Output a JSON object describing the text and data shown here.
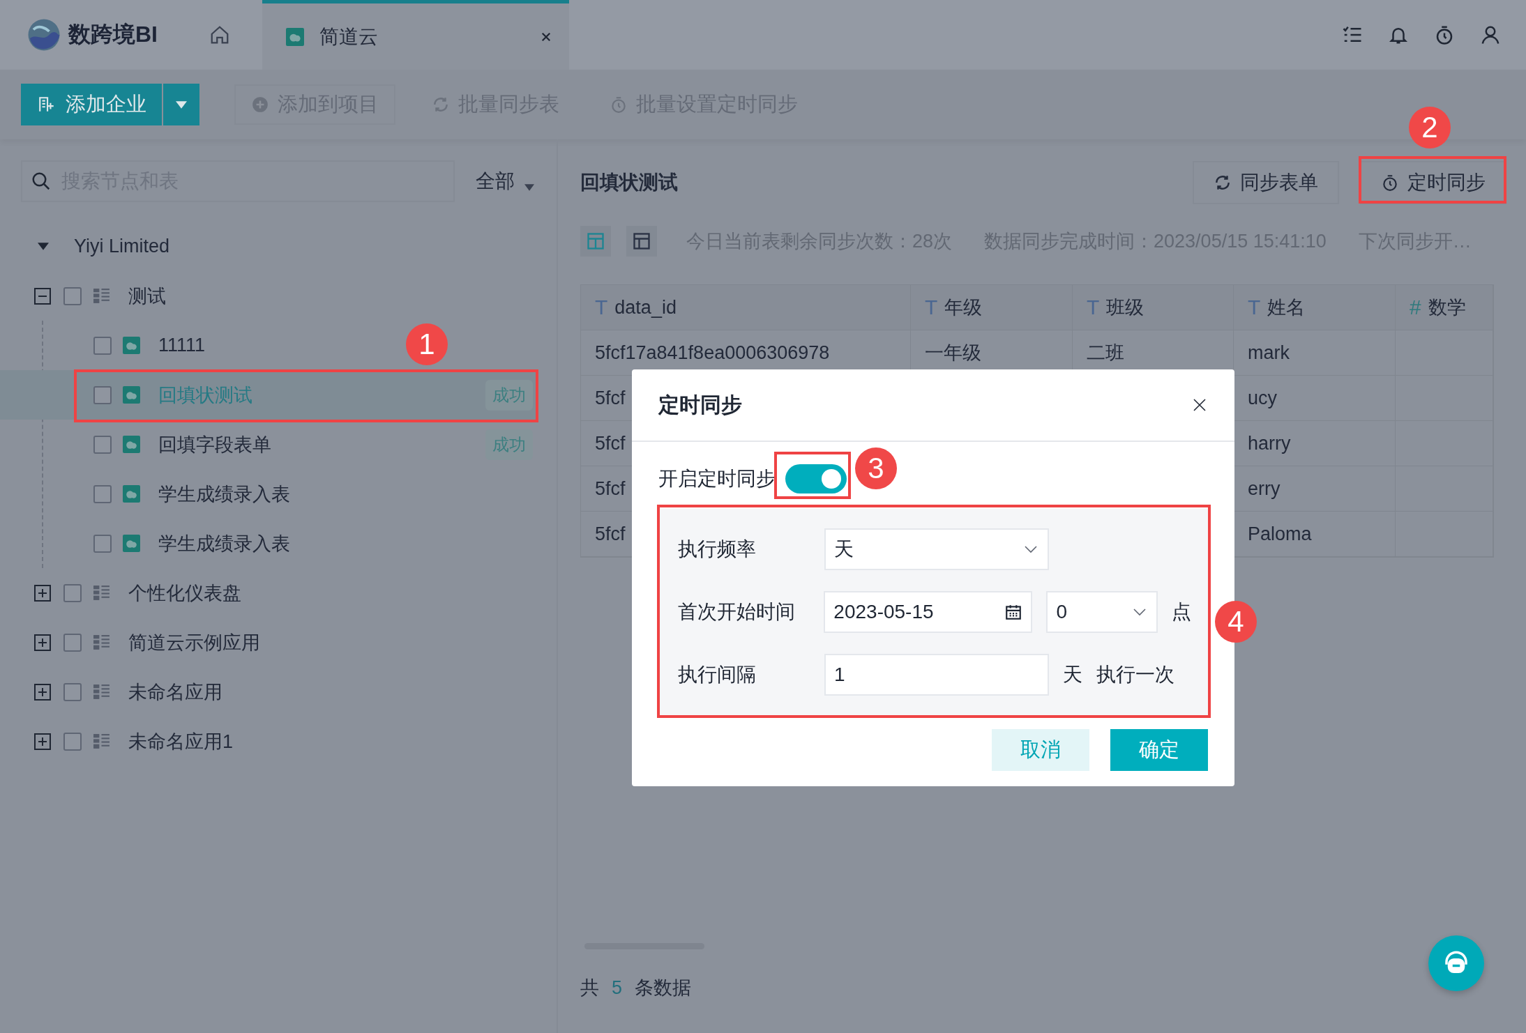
{
  "app": {
    "logo_text": "数跨境BI"
  },
  "tabs": [
    {
      "label": "简道云",
      "selected": true
    }
  ],
  "toolbar": {
    "primary": "添加企业",
    "buttons": [
      {
        "label": "添加到项目",
        "kind": "plus"
      },
      {
        "label": "批量同步表",
        "kind": "refresh"
      },
      {
        "label": "批量设置定时同步",
        "kind": "timer"
      }
    ]
  },
  "search": {
    "placeholder": "搜索节点和表",
    "filter": "全部"
  },
  "tree": {
    "label": "Yiyi Limited",
    "expanded": true,
    "children": [
      {
        "label": "测试",
        "kind": "app",
        "expanded": true,
        "checked": false,
        "selected": false,
        "children": [
          {
            "label": "11111",
            "kind": "form",
            "checked": false,
            "selected": false
          },
          {
            "label": "回填状测试",
            "kind": "form",
            "checked": false,
            "selected": true,
            "status": "成功"
          },
          {
            "label": "回填字段表单",
            "kind": "form",
            "checked": false,
            "selected": false,
            "status": "成功"
          },
          {
            "label": "学生成绩录入表",
            "kind": "form",
            "checked": false,
            "selected": false
          },
          {
            "label": "学生成绩录入表",
            "kind": "form",
            "checked": false,
            "selected": false
          }
        ]
      },
      {
        "label": "个性化仪表盘",
        "kind": "app",
        "expanded": false,
        "checked": false,
        "selected": false
      },
      {
        "label": "简道云示例应用",
        "kind": "app",
        "expanded": false,
        "checked": false,
        "selected": false
      },
      {
        "label": "未命名应用",
        "kind": "app",
        "expanded": false,
        "checked": false,
        "selected": false
      },
      {
        "label": "未命名应用1",
        "kind": "app",
        "expanded": false,
        "checked": false,
        "selected": false
      }
    ]
  },
  "detail": {
    "title": "回填状测试",
    "buttons": [
      {
        "label": "同步表单",
        "kind": "refresh"
      },
      {
        "label": "定时同步",
        "kind": "timer"
      }
    ],
    "views": [
      {
        "kind": "grid",
        "selected": true
      },
      {
        "kind": "layout",
        "selected": false
      }
    ],
    "info": [
      "今日当前表剩余同步次数：28次",
      "数据同步完成时间：2023/05/15 15:41:10",
      "下次同步开…"
    ]
  },
  "table": {
    "columns": [
      {
        "type": "T",
        "label": "data_id"
      },
      {
        "type": "T",
        "label": "年级"
      },
      {
        "type": "T",
        "label": "班级"
      },
      {
        "type": "T",
        "label": "姓名"
      },
      {
        "type": "#",
        "label": "数学"
      }
    ],
    "rows": [
      [
        "5fcf17a841f8ea0006306978",
        "一年级",
        "二班",
        "mark",
        null
      ],
      [
        "5fcf",
        null,
        null,
        "ucy",
        null
      ],
      [
        "5fcf",
        null,
        null,
        "harry",
        null
      ],
      [
        "5fcf",
        null,
        null,
        "erry",
        null
      ],
      [
        "5fcf",
        null,
        null,
        "Paloma",
        null
      ]
    ]
  },
  "footer": {
    "prefix": "共",
    "count": "5",
    "suffix": "条数据"
  },
  "dialog": {
    "title": "定时同步",
    "toggle": {
      "label": "开启定时同步",
      "on": true
    },
    "fields": [
      {
        "label": "执行频率",
        "kind": "select",
        "value": "天"
      },
      {
        "label": "首次开始时间",
        "kind": "datetime",
        "value": "2023-05-15",
        "hour": "0",
        "unit": "点"
      },
      {
        "label": "执行间隔",
        "kind": "number",
        "value": "1",
        "unit": "天",
        "suffix": "执行一次"
      }
    ],
    "cancel": "取消",
    "confirm": "确定"
  },
  "annotations": [
    {
      "number": "1"
    },
    {
      "number": "2"
    },
    {
      "number": "3"
    },
    {
      "number": "4"
    }
  ]
}
